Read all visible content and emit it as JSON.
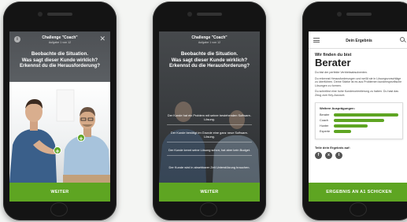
{
  "colors": {
    "accent": "#5ea522",
    "phone": "#141414"
  },
  "screen1": {
    "title": "Challenge \"Coach\"",
    "subtitle": "Aufgabe 1 von 12",
    "headline_line1": "Beobachte die Situation.",
    "headline_line2": "Was sagt dieser Kunde wirklich?",
    "headline_line3": "Erkennst du die Herausforderung?",
    "button": "WEITER",
    "icons": [
      "info-icon",
      "close-icon",
      "plus-icon",
      "plus-icon"
    ]
  },
  "screen2": {
    "title": "Challenge \"Coach\"",
    "subtitle": "Aufgabe 1 von 12",
    "headline_line1": "Beobachte die Situation.",
    "headline_line2": "Was sagt dieser Kunde wirklich?",
    "headline_line3": "Erkennst du die Herausforderung?",
    "options": [
      "Der Kunde hat ein Problem mit seiner bestehenden Software-Lösung.",
      "Der Kunde benötigt im Grunde eine ganz neue Software-Lösung.",
      "Der Kunde kennt seine Lösung schon, hat aber kein Budget.",
      "Der Kunde wird in absehbarer Zeit Unterstützung brauchen."
    ],
    "button": "WEITER"
  },
  "screen3": {
    "title": "Dein Ergebnis",
    "sub": "Wir finden du bist",
    "result": "Berater",
    "para1": "Du bist der perfekte Vertriebsabsolventen.",
    "para2": "Du erkennst Herausforderungen und weißt sie in Lösungsvorschläge zu überführen. Deine Stärke ist es aus Problemen kundenspezifische Lösungen zu formen.",
    "para3": "Du schreibst eine hohe Kundenorientierung zu haben. Du hast das Zeug zum Key-Account.",
    "card_title": "Weitere Ausprägungen:",
    "bars": [
      {
        "label": "Berater",
        "value": 1.0
      },
      {
        "label": "Coach",
        "value": 0.78
      },
      {
        "label": "Hunter",
        "value": 0.52
      },
      {
        "label": "Experte",
        "value": 0.27
      }
    ],
    "share_title": "Teile dein Ergebnis auf:",
    "share_icons": [
      "f",
      "x",
      "t"
    ],
    "button": "ERGEBNIS AN  A1  SCHICKEN"
  }
}
